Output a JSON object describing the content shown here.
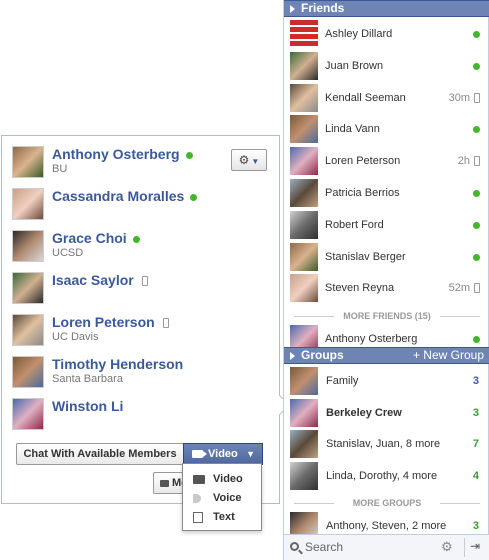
{
  "members": [
    {
      "name": "Anthony Osterberg",
      "sub": "BU",
      "online": true,
      "mobile": false
    },
    {
      "name": "Cassandra Moralles",
      "sub": "",
      "online": true,
      "mobile": false
    },
    {
      "name": "Grace Choi",
      "sub": "UCSD",
      "online": true,
      "mobile": false
    },
    {
      "name": "Isaac Saylor",
      "sub": "",
      "online": false,
      "mobile": true
    },
    {
      "name": "Loren Peterson",
      "sub": "UC Davis",
      "online": false,
      "mobile": true
    },
    {
      "name": "Timothy Henderson",
      "sub": "Santa Barbara",
      "online": false,
      "mobile": false
    },
    {
      "name": "Winston Li",
      "sub": "",
      "online": false,
      "mobile": false
    }
  ],
  "card": {
    "gear_icon": "⚙",
    "chat_button": "Chat With Available Members",
    "video_button": "Video",
    "message_button": "Message",
    "call_menu": [
      "Video",
      "Voice",
      "Text"
    ]
  },
  "friends": {
    "header": "Friends",
    "items": [
      {
        "name": "Ashley Dillard",
        "status": "",
        "online": true,
        "mobile": false
      },
      {
        "name": "Juan Brown",
        "status": "",
        "online": true,
        "mobile": false
      },
      {
        "name": "Kendall Seeman",
        "status": "30m",
        "online": false,
        "mobile": true
      },
      {
        "name": "Linda Vann",
        "status": "",
        "online": true,
        "mobile": false
      },
      {
        "name": "Loren Peterson",
        "status": "2h",
        "online": false,
        "mobile": true
      },
      {
        "name": "Patricia Berrios",
        "status": "",
        "online": true,
        "mobile": false
      },
      {
        "name": "Robert Ford",
        "status": "",
        "online": true,
        "mobile": false
      },
      {
        "name": "Stanislav Berger",
        "status": "",
        "online": true,
        "mobile": false
      },
      {
        "name": "Steven Reyna",
        "status": "52m",
        "online": false,
        "mobile": true
      }
    ],
    "more_label": "MORE FRIENDS (15)",
    "more_items": [
      {
        "name": "Anthony Osterberg",
        "status": "",
        "online": true,
        "mobile": false
      }
    ]
  },
  "groups": {
    "header": "Groups",
    "new_group": "+ New Group",
    "items": [
      {
        "name": "Family",
        "count": "3",
        "bold": false,
        "color": "#3b5998"
      },
      {
        "name": "Berkeley Crew",
        "count": "3",
        "bold": true,
        "color": "#3b9b3b"
      },
      {
        "name": "Stanislav, Juan, 8 more",
        "count": "7",
        "bold": false,
        "color": "#3b9b3b"
      },
      {
        "name": "Linda, Dorothy, 4 more",
        "count": "4",
        "bold": false,
        "color": "#3b9b3b"
      }
    ],
    "more_label": "MORE GROUPS",
    "more_items": [
      {
        "name": "Anthony, Steven, 2 more",
        "count": "3",
        "bold": false,
        "color": "#3b9b3b"
      }
    ]
  },
  "search": {
    "label": "Search",
    "gear_icon": "⚙",
    "exit_icon": "⇥"
  },
  "colors": {
    "brand": "#3b5998",
    "header": "#6d84b4",
    "online": "#42b72a"
  }
}
